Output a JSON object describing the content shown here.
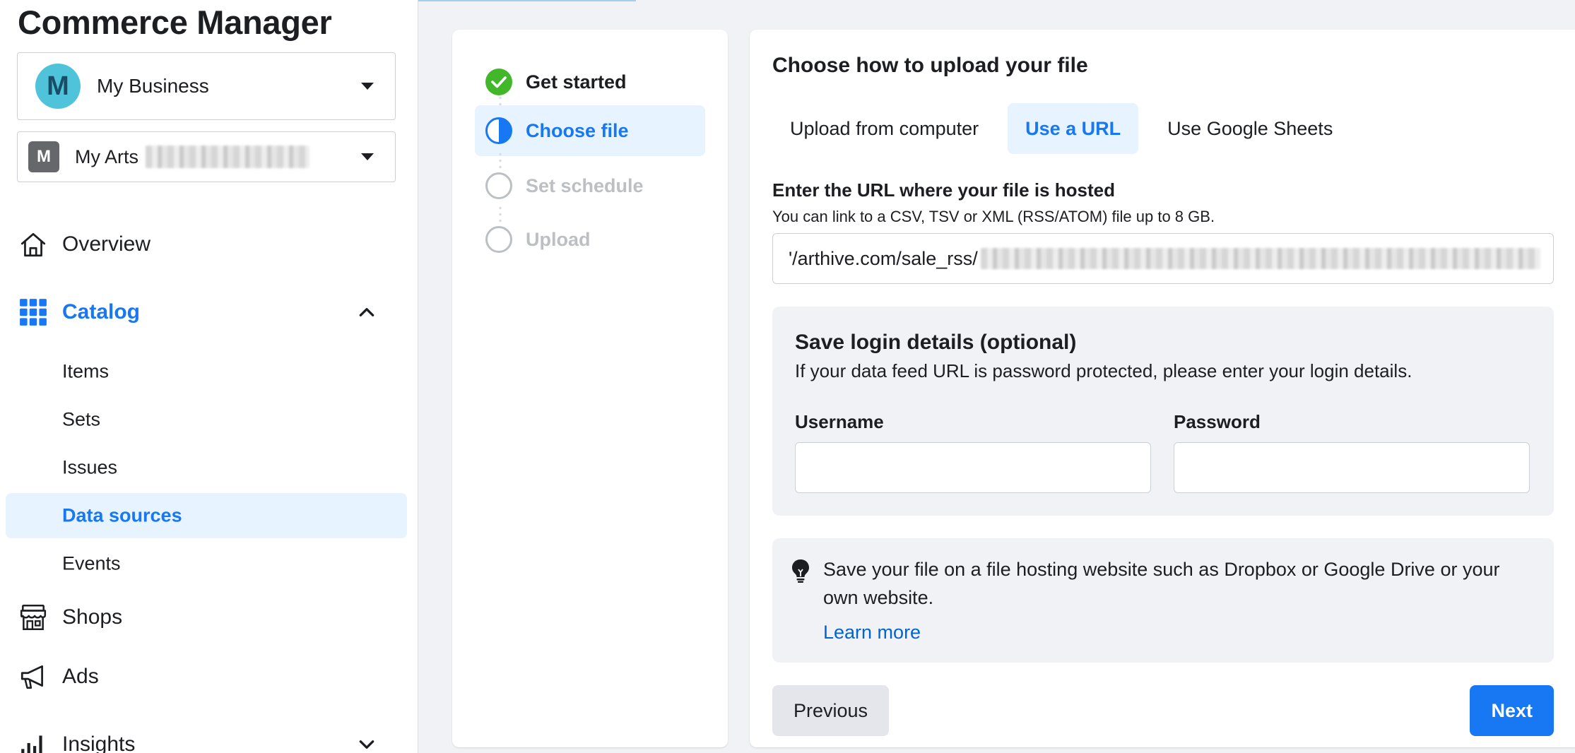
{
  "app": {
    "title": "Commerce Manager"
  },
  "business_selector": {
    "avatar_letter": "M",
    "name": "My Business",
    "icon": "caret-down-icon"
  },
  "catalog_selector": {
    "avatar_letter": "M",
    "name": "My Arts",
    "icon": "caret-down-icon"
  },
  "sidebar": {
    "overview": {
      "label": "Overview",
      "icon": "home-icon"
    },
    "catalog": {
      "label": "Catalog",
      "icon": "grid-icon",
      "expanded": true,
      "items": [
        {
          "label": "Items"
        },
        {
          "label": "Sets"
        },
        {
          "label": "Issues"
        },
        {
          "label": "Data sources",
          "selected": true
        },
        {
          "label": "Events"
        }
      ]
    },
    "shops": {
      "label": "Shops",
      "icon": "storefront-icon"
    },
    "ads": {
      "label": "Ads",
      "icon": "megaphone-icon"
    },
    "insights": {
      "label": "Insights",
      "icon": "bar-chart-icon"
    }
  },
  "steps": [
    {
      "label": "Get started",
      "status": "done"
    },
    {
      "label": "Choose file",
      "status": "current"
    },
    {
      "label": "Set schedule",
      "status": "todo"
    },
    {
      "label": "Upload",
      "status": "todo"
    }
  ],
  "upload": {
    "title": "Choose how to upload your file",
    "tabs": [
      {
        "label": "Upload from computer",
        "active": false
      },
      {
        "label": "Use a URL",
        "active": true
      },
      {
        "label": "Use Google Sheets",
        "active": false
      }
    ],
    "url_label": "Enter the URL where your file is hosted",
    "url_help": "You can link to a CSV, TSV or XML (RSS/ATOM) file up to 8 GB.",
    "url_value": "'/arthive.com/sale_rss/"
  },
  "login": {
    "title": "Save login details (optional)",
    "description": "If your data feed URL is password protected, please enter your login details.",
    "username_label": "Username",
    "password_label": "Password"
  },
  "tip": {
    "icon": "lightbulb-icon",
    "text": "Save your file on a file hosting website such as Dropbox or Google Drive or your own website.",
    "link": "Learn more"
  },
  "buttons": {
    "previous": "Previous",
    "next": "Next"
  },
  "colors": {
    "accent": "#1877f2",
    "selected_bg": "#e7f3ff",
    "done_green": "#42b72a",
    "avatar_teal": "#4fc3d9"
  }
}
